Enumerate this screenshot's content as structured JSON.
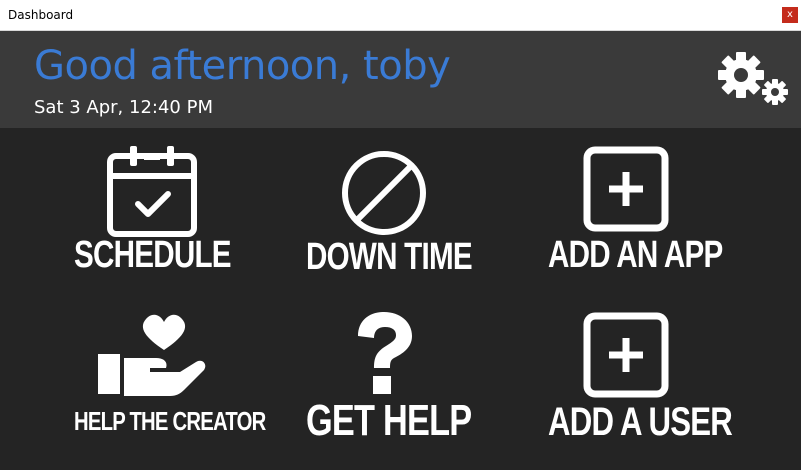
{
  "window": {
    "title": "Dashboard",
    "close_label": "x"
  },
  "header": {
    "greeting": "Good afternoon, toby",
    "datetime": "Sat 3 Apr, 12:40 PM",
    "settings_icon": "gears-icon"
  },
  "tiles": [
    {
      "label": "SCHEDULE",
      "icon": "calendar-check-icon"
    },
    {
      "label": "DOWN TIME",
      "icon": "no-entry-icon"
    },
    {
      "label": "ADD AN APP",
      "icon": "add-square-icon"
    },
    {
      "label": "HELP THE CREATOR",
      "icon": "heart-hand-icon"
    },
    {
      "label": "GET HELP",
      "icon": "question-mark-icon"
    },
    {
      "label": "ADD A USER",
      "icon": "add-square-icon"
    }
  ],
  "colors": {
    "accent": "#3a7bd5",
    "header_bg": "#3a3a3a",
    "main_bg": "#242424",
    "close_red": "#c42b1c"
  }
}
